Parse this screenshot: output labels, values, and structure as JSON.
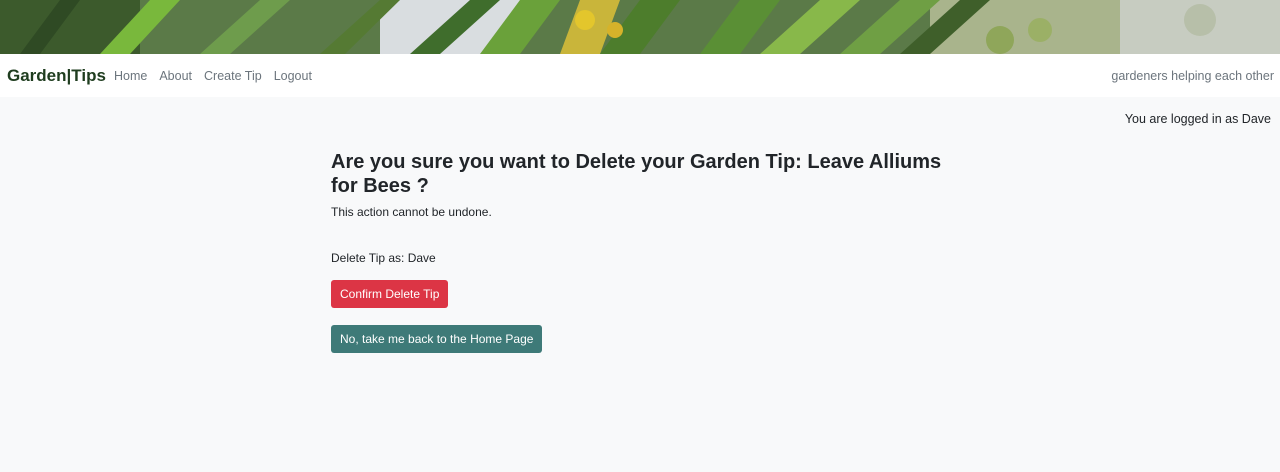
{
  "nav": {
    "brand": "Garden|Tips",
    "links": [
      "Home",
      "About",
      "Create Tip",
      "Logout"
    ],
    "tagline": "gardeners helping each other"
  },
  "login_status": "You are logged in as Dave",
  "main": {
    "title": "Are you sure you want to Delete your Garden Tip: Leave Alliums for Bees ?",
    "subtitle": "This action cannot be undone.",
    "delete_as": "Delete Tip as: Dave",
    "confirm_label": "Confirm Delete Tip",
    "back_label": "No, take me back to the Home Page"
  },
  "colors": {
    "confirm_button": "#dc3545",
    "back_button": "#3e7a78",
    "brand": "#1f3d1f",
    "background": "#f8f9fa"
  }
}
